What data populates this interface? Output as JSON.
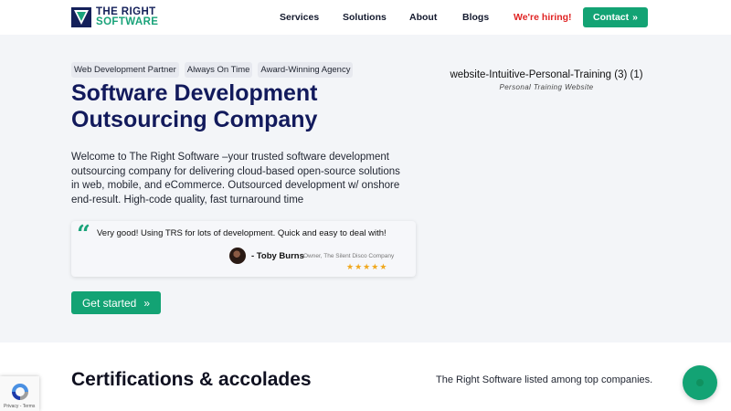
{
  "brand": {
    "line1": "THE RIGHT",
    "line2": "SOFTWARE",
    "navy": "#14205a",
    "green": "#1aa37a"
  },
  "nav": {
    "items": [
      {
        "label": "Services"
      },
      {
        "label": "Solutions"
      },
      {
        "label": "About"
      },
      {
        "label": "Blogs"
      },
      {
        "label": "We're hiring!"
      }
    ],
    "contact_label": "Contact",
    "contact_icon": "double-chevron-right-icon"
  },
  "hero": {
    "tags": [
      "Web Development Partner",
      "Always On Time",
      "Award-Winning Agency"
    ],
    "title": "Software Development Outsourcing Company",
    "description": "Welcome to The Right Software –your trusted software development outsourcing company for delivering cloud-based open-source solutions in web, mobile, and eCommerce. Outsourced development w/ onshore end-result. High-code quality, fast turnaround time",
    "testimonial": {
      "quote": "Very good! Using TRS for lots of development. Quick and easy to deal with!",
      "author": "- Toby Burns",
      "role": "Owner, The Silent Disco Company",
      "rating": 5
    },
    "cta_label": "Get started",
    "media": {
      "title": "website-Intuitive-Personal-Training (3) (1)",
      "subtitle": "Personal Training Website"
    }
  },
  "certifications": {
    "title": "Certifications & accolades",
    "note": "The Right Software listed among top companies."
  },
  "recaptcha": {
    "links": "Privacy - Terms"
  },
  "colors": {
    "accent": "#13a374",
    "hiring": "#e02424",
    "hero_bg": "#f3f5f8",
    "star": "#f0a81e"
  }
}
